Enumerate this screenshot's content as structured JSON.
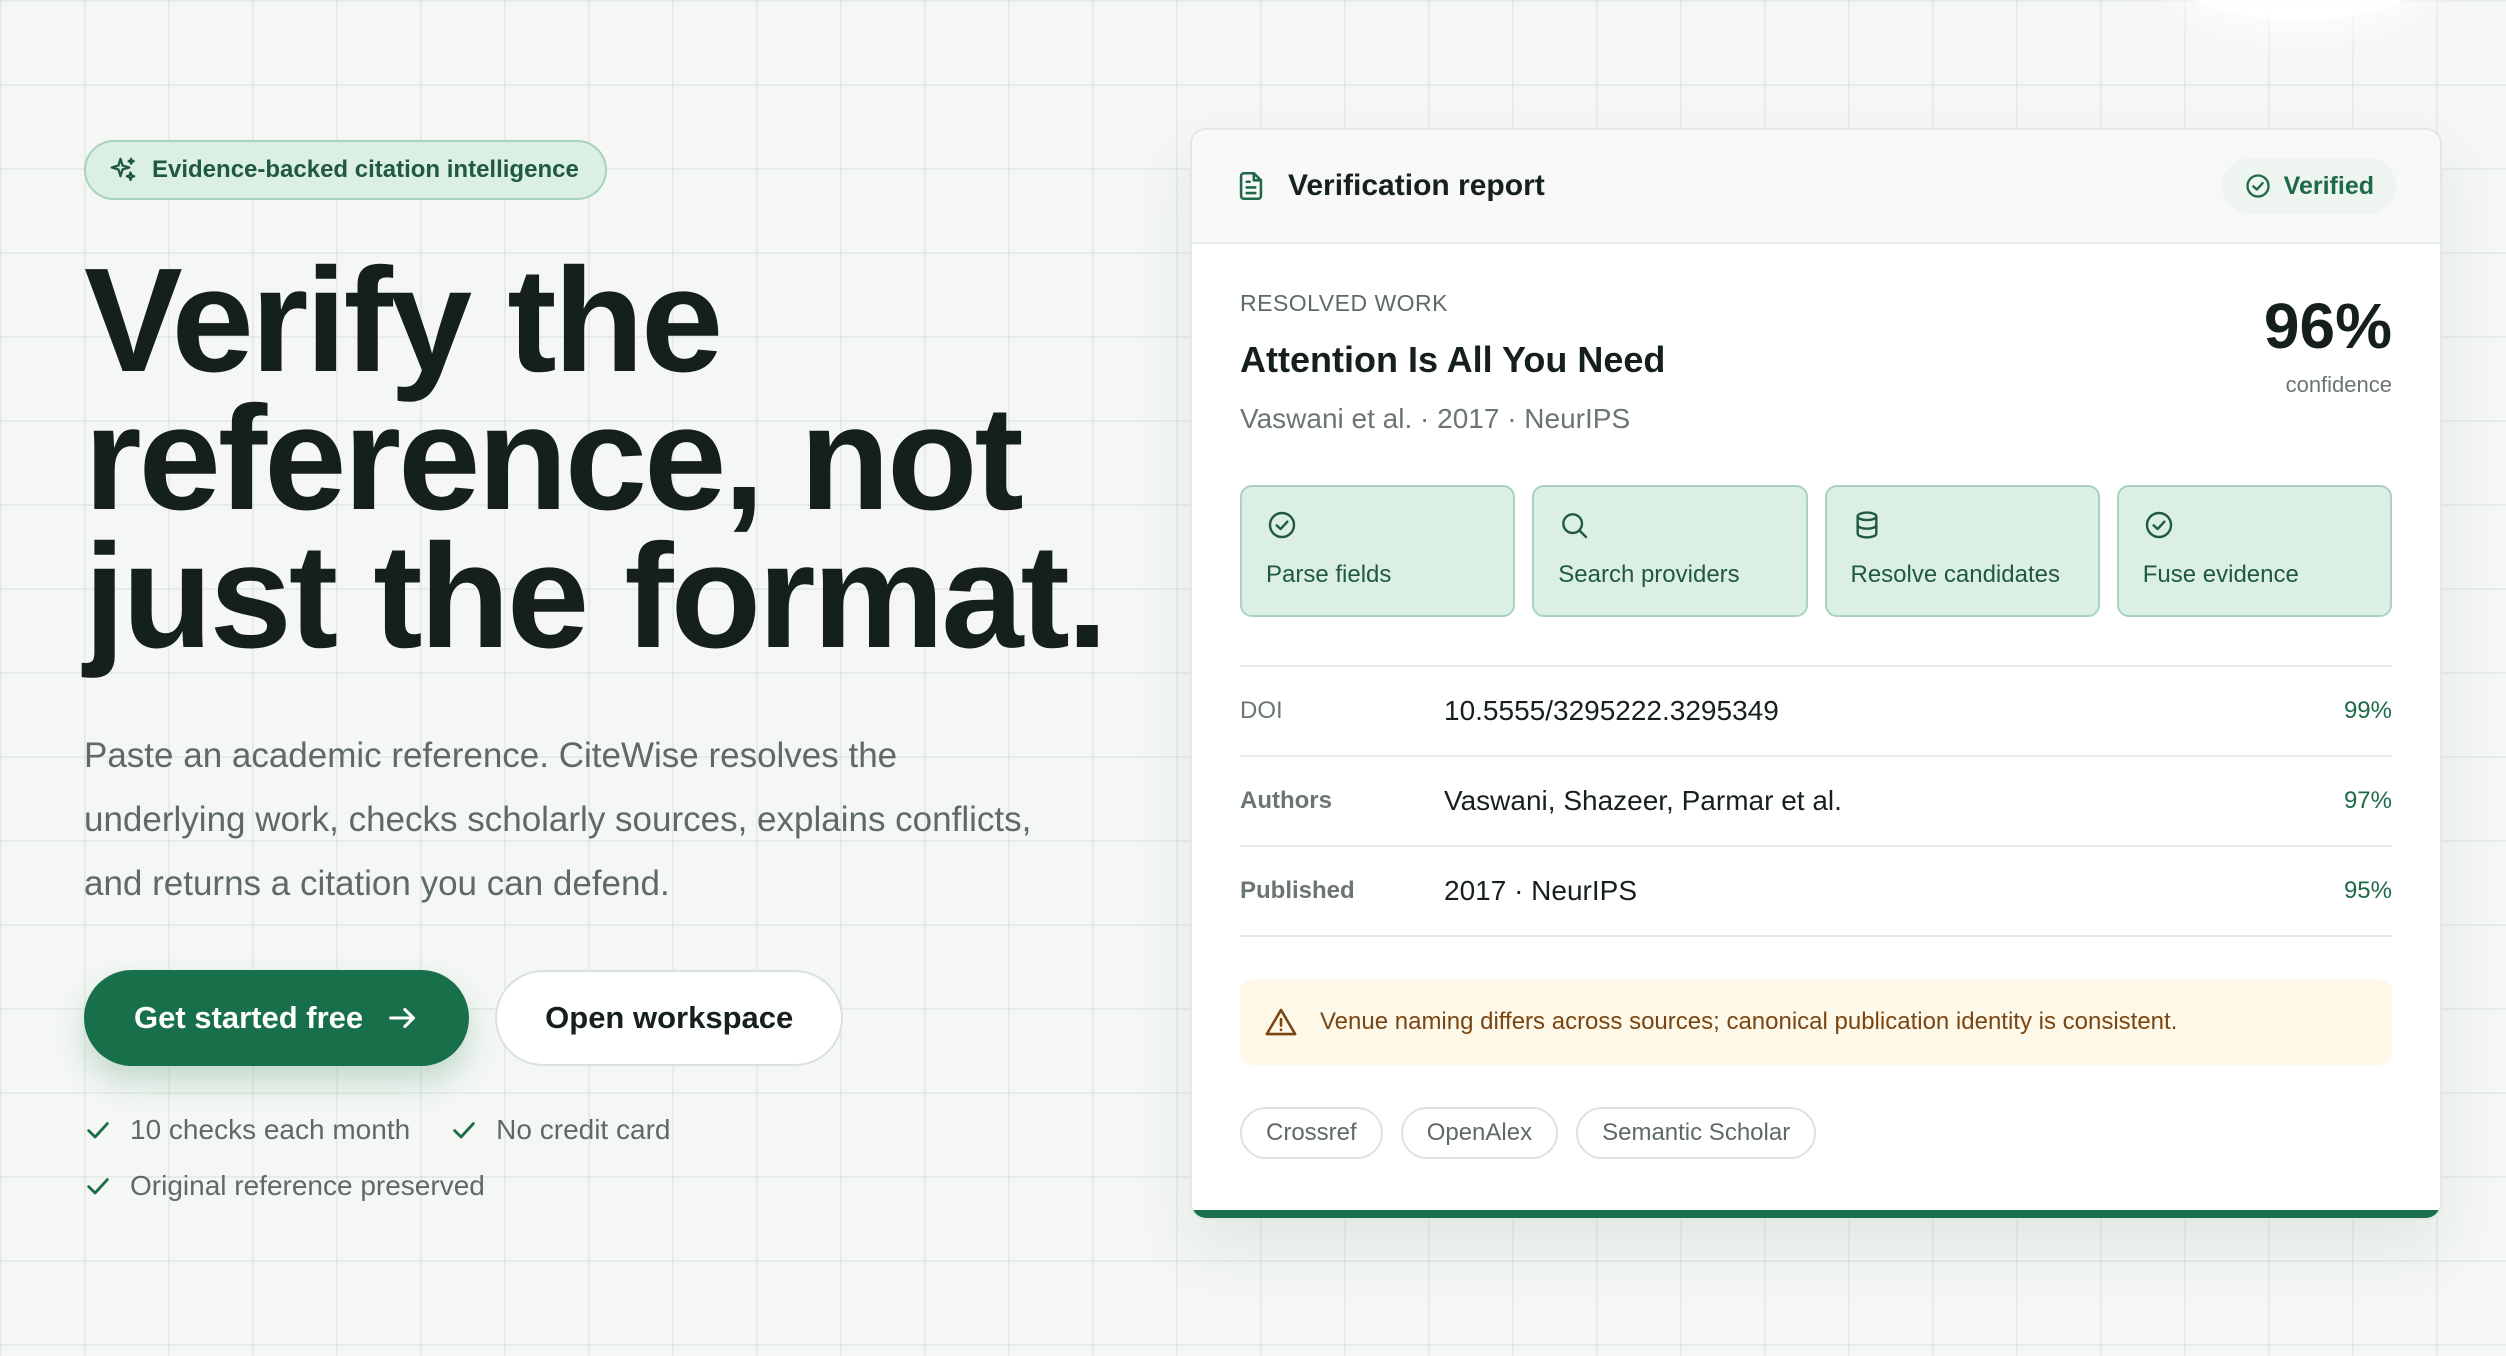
{
  "hero": {
    "badge": "Evidence-backed citation intelligence",
    "headline_lines": [
      "Verify the",
      "reference, not",
      "just the format."
    ],
    "lede_lines": [
      "Paste an academic reference. CiteWise resolves the",
      "underlying work, checks scholarly sources, explains conflicts,",
      "and returns a citation you can defend."
    ],
    "primary_cta": "Get started free",
    "secondary_cta": "Open workspace",
    "checks": [
      "10 checks each month",
      "No credit card",
      "Original reference preserved"
    ]
  },
  "report": {
    "title": "Verification report",
    "status": "Verified",
    "resolved_label": "RESOLVED WORK",
    "work_title": "Attention Is All You Need",
    "work_meta": "Vaswani et al. · 2017 · NeurIPS",
    "confidence_value": "96%",
    "confidence_label": "confidence",
    "steps": [
      {
        "label": "Parse fields",
        "icon": "check-circle-icon"
      },
      {
        "label": "Search providers",
        "icon": "search-icon"
      },
      {
        "label": "Resolve candidates",
        "icon": "database-icon"
      },
      {
        "label": "Fuse evidence",
        "icon": "check-circle-icon"
      }
    ],
    "fields": [
      {
        "key": "DOI",
        "value": "10.5555/3295222.3295349",
        "confidence": "99%"
      },
      {
        "key": "Authors",
        "value": "Vaswani, Shazeer, Parmar et al.",
        "confidence": "97%"
      },
      {
        "key": "Published",
        "value": "2017 · NeurIPS",
        "confidence": "95%"
      }
    ],
    "warning": "Venue naming differs across sources; canonical publication identity is consistent.",
    "sources": [
      "Crossref",
      "OpenAlex",
      "Semantic Scholar"
    ]
  },
  "colors": {
    "accent": "#17704a",
    "accent_soft": "#dcefe5",
    "warning_bg": "#fdf8e8",
    "warning_text": "#7a4512"
  }
}
